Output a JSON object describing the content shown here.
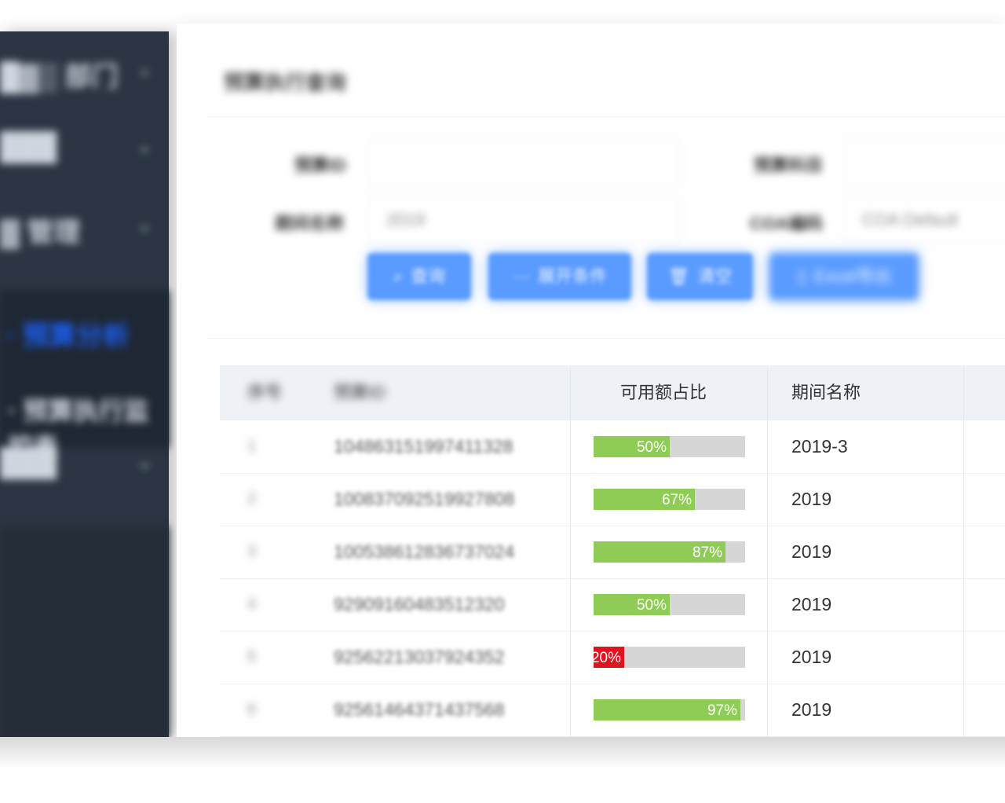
{
  "sidebar": {
    "items": [
      {
        "label": "█▓▒ 部门"
      },
      {
        "label": "███"
      },
      {
        "label": "▓ 管理"
      },
      {
        "label": "███"
      }
    ],
    "sub_active": "· 预算分析",
    "sub_second": "· 预算执行监控表",
    "chevron": "⌄"
  },
  "page": {
    "title": "预算执行查询"
  },
  "form": {
    "label1": "预算ID",
    "label2": "预算科目",
    "label3": "期间名称",
    "label4": "COA编码",
    "input1": "",
    "input2": "",
    "input3": "2019",
    "input4": "COA Default"
  },
  "buttons": {
    "search": "查询",
    "expand": "展开条件",
    "clear": "清空",
    "export": "Excel导出"
  },
  "table": {
    "headers": {
      "index": "序号",
      "id": "预算ID",
      "ratio": "可用额占比",
      "period": "期间名称"
    },
    "rows": [
      {
        "index": "1",
        "id": "104863151997411328",
        "ratio": 0.5,
        "ratio_label": "50%",
        "period": "2019-3",
        "color": "#8fcc55"
      },
      {
        "index": "2",
        "id": "100837092519927808",
        "ratio": 0.67,
        "ratio_label": "67%",
        "period": "2019",
        "color": "#8fcc55"
      },
      {
        "index": "3",
        "id": "100538612836737024",
        "ratio": 0.87,
        "ratio_label": "87%",
        "period": "2019",
        "color": "#8fcc55"
      },
      {
        "index": "4",
        "id": "92909160483512320",
        "ratio": 0.5,
        "ratio_label": "50%",
        "period": "2019",
        "color": "#8fcc55"
      },
      {
        "index": "5",
        "id": "92562213037924352",
        "ratio": 0.2,
        "ratio_label": "20%",
        "period": "2019",
        "color": "#e0141e"
      },
      {
        "index": "6",
        "id": "92561464371437568",
        "ratio": 0.97,
        "ratio_label": "97%",
        "period": "2019",
        "color": "#8fcc55"
      }
    ]
  },
  "colors": {
    "sidebar_bg": "#2b3543",
    "accent_blue": "#5a9bff",
    "progress_green": "#8fcc55",
    "progress_red": "#e0141e",
    "progress_track": "#d6d6d6"
  }
}
